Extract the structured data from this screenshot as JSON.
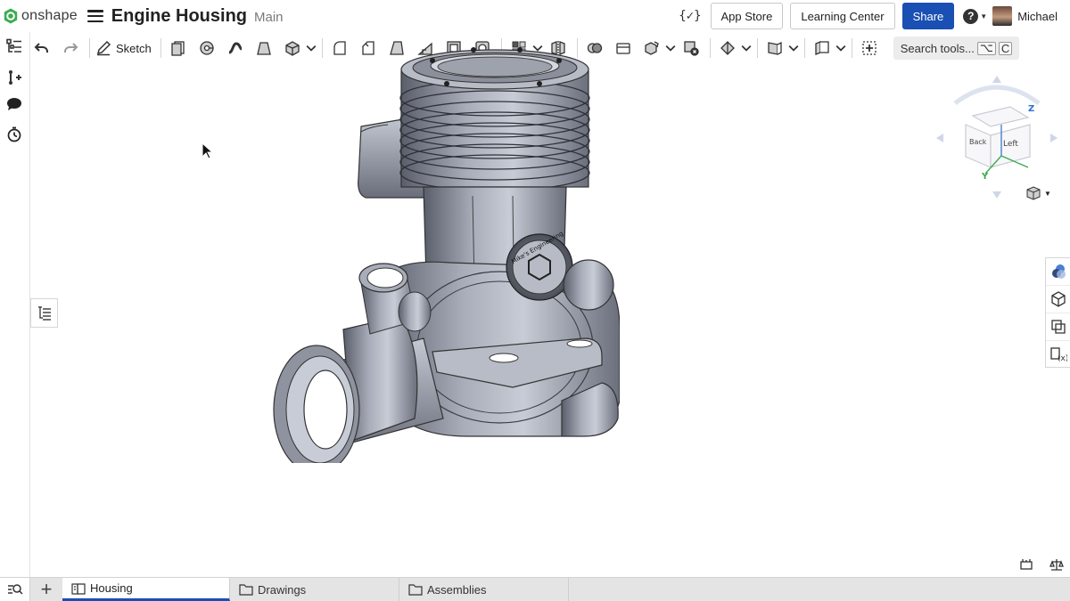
{
  "brand": {
    "name": "onshape",
    "color": "#3bac52"
  },
  "document": {
    "title": "Engine Housing",
    "branch": "Main"
  },
  "header": {
    "featurescript_icon": "{✓}",
    "app_store": "App Store",
    "learning_center": "Learning Center",
    "share": "Share",
    "user_name": "Michael",
    "share_color": "#1a4fb3"
  },
  "toolbar": {
    "sketch_label": "Sketch",
    "search_placeholder": "Search tools...",
    "search_shortcut": [
      "⌥",
      "C"
    ]
  },
  "viewcube": {
    "faces": [
      "Back",
      "Left"
    ],
    "axes": [
      "Z",
      "Y"
    ]
  },
  "model": {
    "emblem_text": "Mike's Engineering"
  },
  "tabs": [
    {
      "label": "Housing",
      "type": "part-studio",
      "active": true
    },
    {
      "label": "Drawings",
      "type": "folder",
      "active": false
    },
    {
      "label": "Assemblies",
      "type": "folder",
      "active": false
    }
  ]
}
